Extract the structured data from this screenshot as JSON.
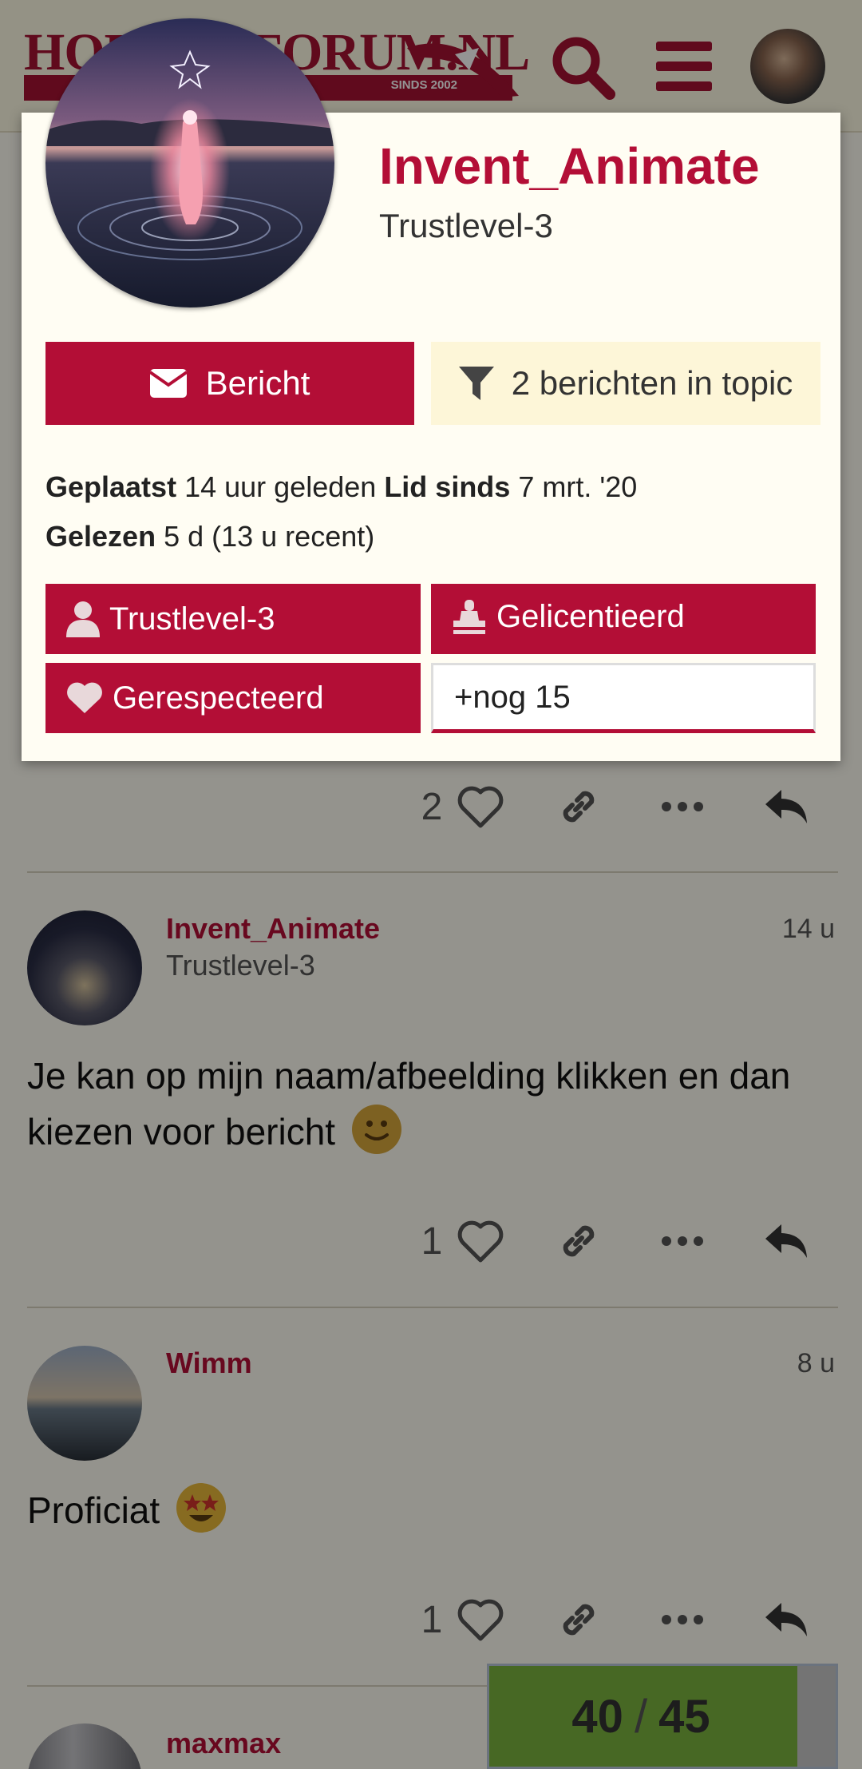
{
  "header": {
    "logo_text": "HORECAFORUM.NL",
    "logo_sub": "SINDS 2002"
  },
  "posts": [
    {
      "likes": "2"
    },
    {
      "username": "Invent_Animate",
      "user_title": "Trustlevel-3",
      "time": "14 u",
      "body": "Je kan op mijn naam/afbeelding klikken en dan kiezen voor bericht",
      "likes": "1"
    },
    {
      "username": "Wimm",
      "time": "8 u",
      "body": "Proficiat",
      "likes": "1"
    },
    {
      "username": "maxmax"
    }
  ],
  "timeline": {
    "current": "40",
    "separator": "/",
    "total": "45",
    "progress_fraction": 0.889
  },
  "user_card": {
    "username": "Invent_Animate",
    "title": "Trustlevel-3",
    "message_button": "Bericht",
    "filter_button": "2 berichten in topic",
    "posted_label": "Geplaatst",
    "posted_value": "14 uur geleden",
    "member_since_label": "Lid sinds",
    "member_since_value": "7 mrt. '20",
    "read_label": "Gelezen",
    "read_value": "5 d (13 u recent)",
    "badges": [
      "Trustlevel-3",
      "Gelicentieerd",
      "Gerespecteerd"
    ],
    "more_badges": "+nog 15"
  },
  "colors": {
    "brand": "#b30e36",
    "background": "#fffdf3",
    "header_bg": "#fffbe6",
    "filter_bg": "#fdf6d8",
    "timeline_fill": "#7ab33f"
  }
}
